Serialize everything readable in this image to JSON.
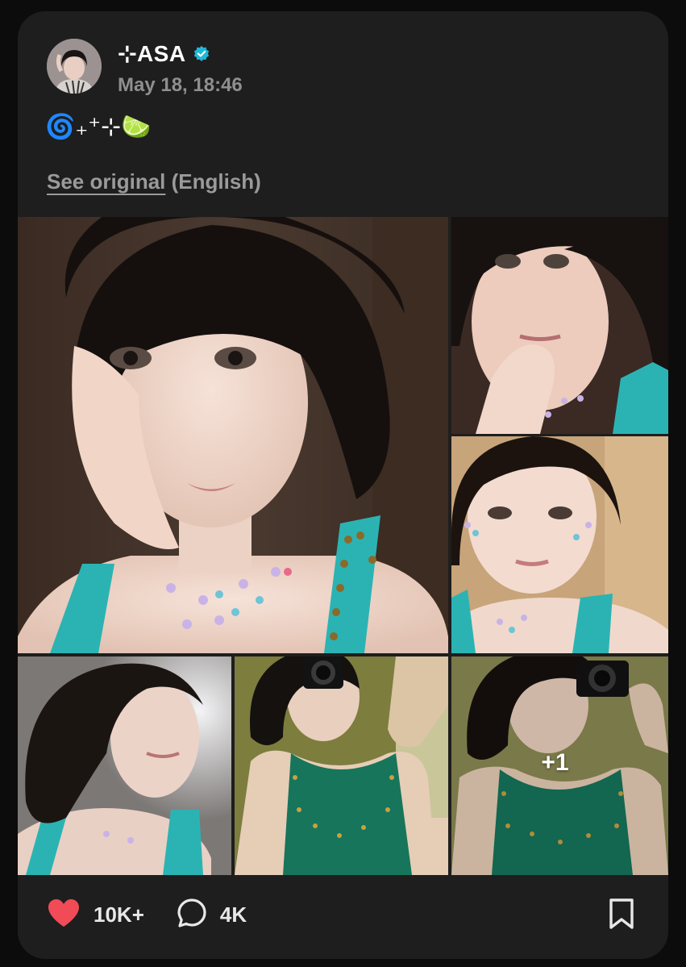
{
  "post": {
    "author": {
      "name": "⊹ASA",
      "verified": true,
      "avatar": "profile-photo"
    },
    "timestamp": "May 18, 18:46",
    "caption": "🌀₊⁺⊹🍋‍🟩",
    "translate": {
      "link_label": "See original",
      "language_label": "(English)"
    },
    "photos": [
      {
        "id": "photo-1"
      },
      {
        "id": "photo-2"
      },
      {
        "id": "photo-3"
      },
      {
        "id": "photo-4"
      },
      {
        "id": "photo-5"
      },
      {
        "id": "photo-6",
        "more_overlay": "+1"
      }
    ],
    "actions": {
      "likes": "10K+",
      "comments": "4K",
      "like_icon": "heart-icon",
      "comment_icon": "comment-icon",
      "bookmark_icon": "bookmark-icon"
    }
  },
  "colors": {
    "background": "#0c0c0c",
    "card": "#1e1e1e",
    "heart": "#f04b57",
    "verified_badge": "#1eb8d8",
    "muted_text": "#8f8f8f"
  }
}
